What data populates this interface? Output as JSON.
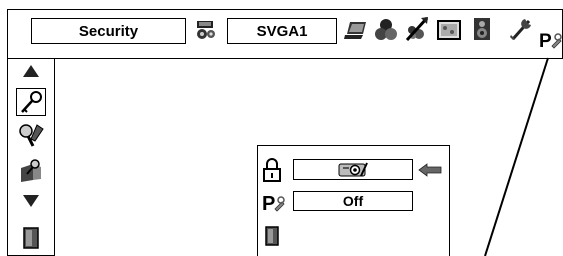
{
  "menu": {
    "title": "Security",
    "input_source": "SVGA1",
    "top_icons": [
      "computer-icon",
      "color-icon",
      "image-adjust-icon",
      "screen-icon",
      "sound-icon",
      "setting-icon",
      "security-icon"
    ],
    "side_icons": [
      "up-arrow-icon",
      "key-icon",
      "pin-code-lock-icon",
      "logo-lock-icon",
      "down-arrow-icon",
      "exit-icon"
    ]
  },
  "security_panel": {
    "rows": [
      {
        "icon": "lock-icon",
        "value_icon": "projector-icon"
      },
      {
        "icon": "pin-code-lock-icon",
        "value": "Off"
      },
      {
        "icon": "exit-icon"
      }
    ]
  }
}
